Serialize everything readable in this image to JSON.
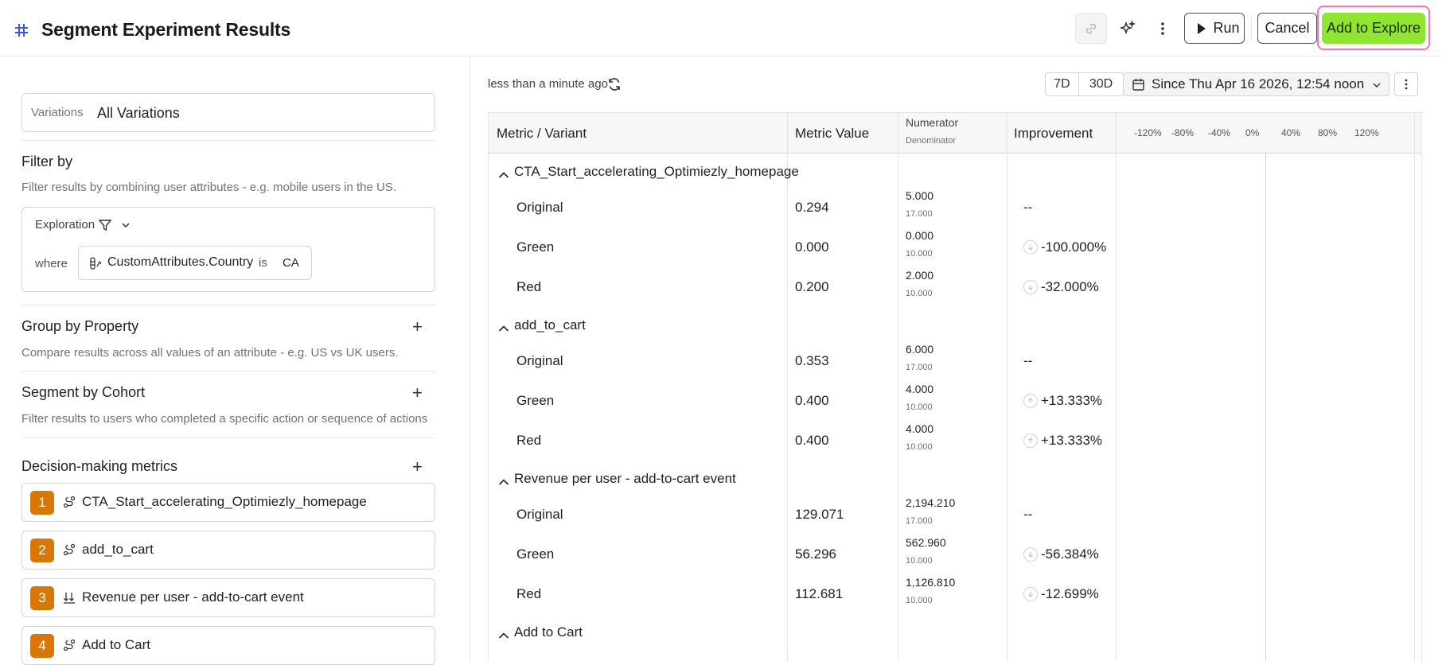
{
  "header": {
    "title": "Segment Experiment Results",
    "run_label": "Run",
    "cancel_label": "Cancel",
    "add_to_explore_label": "Add to Explore"
  },
  "left": {
    "variations_label": "Variations",
    "variations_value": "All Variations",
    "filter_title": "Filter by",
    "filter_desc": "Filter results by combining user attributes - e.g. mobile users in the US.",
    "exploration_label": "Exploration",
    "where_label": "where",
    "condition": {
      "attribute": "CustomAttributes.Country",
      "operator": "is",
      "value": "CA"
    },
    "group_title": "Group by Property",
    "group_desc": "Compare results across all values of an attribute - e.g. US vs UK users.",
    "cohort_title": "Segment by Cohort",
    "cohort_desc": "Filter results to users who completed a specific action or sequence of actions",
    "metrics_title": "Decision-making metrics",
    "metrics": [
      {
        "num": "1",
        "icon": "funnel-event-icon",
        "name": "CTA_Start_accelerating_Optimiezly_homepage"
      },
      {
        "num": "2",
        "icon": "funnel-event-icon",
        "name": "add_to_cart"
      },
      {
        "num": "3",
        "icon": "sort-down-icon",
        "name": "Revenue per user - add-to-cart event"
      },
      {
        "num": "4",
        "icon": "funnel-event-icon",
        "name": "Add to Cart"
      }
    ]
  },
  "right": {
    "updated": "less than a minute ago",
    "range_7d": "7D",
    "range_30d": "30D",
    "date_range": "Since Thu Apr 16 2026, 12:54 noon",
    "table": {
      "col_metric": "Metric / Variant",
      "col_value": "Metric Value",
      "col_numerator": "Numerator",
      "col_denominator": "Denominator",
      "col_improvement": "Improvement",
      "ticks": [
        "-120%",
        "-80%",
        "-40%",
        "0%",
        "40%",
        "80%",
        "120%"
      ],
      "groups": [
        {
          "name": "CTA_Start_accelerating_Optimiezly_homepage",
          "rows": [
            {
              "variant": "Original",
              "value": "0.294",
              "numerator": "5.000",
              "denominator": "17.000",
              "improvement": "--",
              "direction": "none"
            },
            {
              "variant": "Green",
              "value": "0.000",
              "numerator": "0.000",
              "denominator": "10.000",
              "improvement": "-100.000%",
              "direction": "down"
            },
            {
              "variant": "Red",
              "value": "0.200",
              "numerator": "2.000",
              "denominator": "10.000",
              "improvement": "-32.000%",
              "direction": "down"
            }
          ]
        },
        {
          "name": "add_to_cart",
          "rows": [
            {
              "variant": "Original",
              "value": "0.353",
              "numerator": "6.000",
              "denominator": "17.000",
              "improvement": "--",
              "direction": "none"
            },
            {
              "variant": "Green",
              "value": "0.400",
              "numerator": "4.000",
              "denominator": "10.000",
              "improvement": "+13.333%",
              "direction": "up"
            },
            {
              "variant": "Red",
              "value": "0.400",
              "numerator": "4.000",
              "denominator": "10.000",
              "improvement": "+13.333%",
              "direction": "up"
            }
          ]
        },
        {
          "name": "Revenue per user - add-to-cart event",
          "rows": [
            {
              "variant": "Original",
              "value": "129.071",
              "numerator": "2,194.210",
              "denominator": "17.000",
              "improvement": "--",
              "direction": "none"
            },
            {
              "variant": "Green",
              "value": "56.296",
              "numerator": "562.960",
              "denominator": "10.000",
              "improvement": "-56.384%",
              "direction": "down"
            },
            {
              "variant": "Red",
              "value": "112.681",
              "numerator": "1,126.810",
              "denominator": "10.000",
              "improvement": "-12.699%",
              "direction": "down"
            }
          ]
        },
        {
          "name": "Add to Cart",
          "rows": []
        }
      ]
    }
  }
}
